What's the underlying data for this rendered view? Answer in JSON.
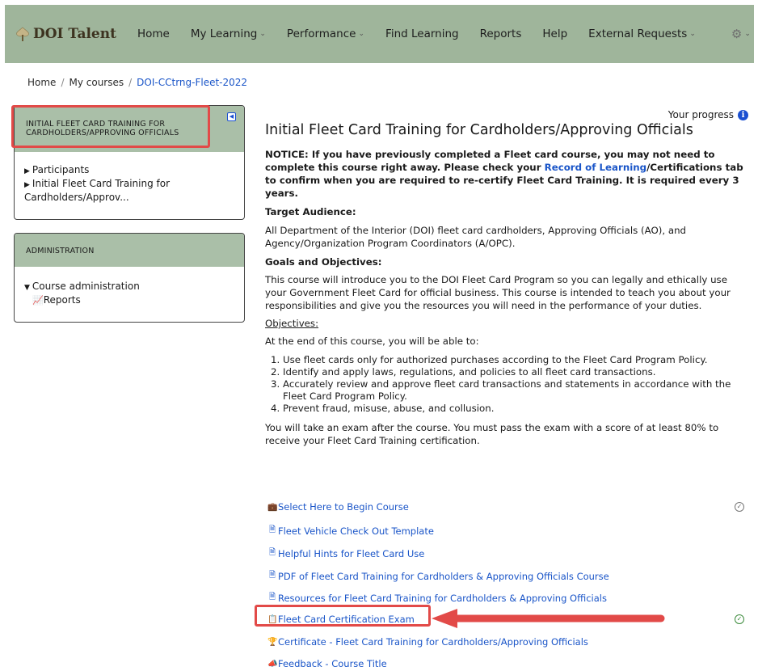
{
  "nav": {
    "brand": "DOI Talent",
    "items": [
      "Home",
      "My Learning",
      "Performance",
      "Find Learning",
      "Reports",
      "Help",
      "External Requests"
    ]
  },
  "breadcrumb": [
    "Home",
    "My courses",
    "DOI-CCtrng-Fleet-2022"
  ],
  "sidebar": {
    "course_block": {
      "title": "INITIAL FLEET CARD TRAINING FOR CARDHOLDERS/APPROVING OFFICIALS",
      "items": [
        "Participants",
        "Initial Fleet Card Training for Cardholders/Approv..."
      ]
    },
    "admin_block": {
      "title": "ADMINISTRATION",
      "section": "Course administration",
      "items": [
        "Reports"
      ]
    }
  },
  "main": {
    "progress_label": "Your progress",
    "title": "Initial Fleet Card Training for Cardholders/Approving Officials",
    "notice_a": "NOTICE:  If you have previously completed a Fleet card course, you may not need to complete this course right away.  Please check your ",
    "notice_link": "Record of Learning",
    "notice_b": "/Certifications tab to confirm when you are required to re-certify Fleet Card Training.  It is required every 3 years.",
    "audience_heading": "Target Audience:",
    "audience_text": "All Department of the Interior (DOI) fleet card cardholders, Approving Officials (AO), and Agency/Organization Program Coordinators (A/OPC).",
    "goals_heading": "Goals and Objectives:",
    "goals_text": "This course will introduce you to the DOI Fleet Card Program so you can legally and ethically use your Government Fleet Card for official business. This course is intended to teach you about your responsibilities and give you the resources you will need in the performance of your duties.",
    "objectives_heading": "Objectives:",
    "objectives_intro": "At the end of this course, you will be able to:",
    "objectives": [
      "Use fleet cards only for authorized purchases according to the Fleet Card Program Policy.",
      "Identify and apply laws, regulations, and policies to all  fleet card transactions.",
      "Accurately review and approve fleet card transactions and statements in accordance with the Fleet Card Program Policy.",
      "Prevent fraud, misuse, abuse, and collusion."
    ],
    "exam_text": "You will take an exam after the course. You must pass the exam with a score of at least 80% to receive your Fleet Card Training certification."
  },
  "activities": [
    {
      "label": "Select Here to Begin Course",
      "icon": "package-icon",
      "completion": "incomplete"
    },
    {
      "label": "Fleet Vehicle Check Out Template",
      "icon": "file-icon",
      "completion": "none"
    },
    {
      "label": "Helpful Hints for Fleet Card Use",
      "icon": "file-icon",
      "completion": "none"
    },
    {
      "label": "PDF of Fleet Card Training for Cardholders & Approving Officials Course",
      "icon": "file-icon",
      "completion": "none"
    },
    {
      "label": "Resources for Fleet Card Training for Cardholders & Approving Officials",
      "icon": "file-icon",
      "completion": "none"
    },
    {
      "label": "Fleet Card Certification Exam",
      "icon": "quiz-icon",
      "completion": "complete"
    },
    {
      "label": "Certificate - Fleet Card Training for Cardholders/Approving Officials",
      "icon": "certificate-icon",
      "completion": "none"
    },
    {
      "label": "Feedback - Course Title",
      "icon": "feedback-icon",
      "completion": "none"
    }
  ],
  "colors": {
    "navbar": "#9fb59b",
    "block_header": "#aabfa8",
    "link": "#1a55c8",
    "highlight": "#e24a48",
    "info": "#1a4fd1"
  }
}
